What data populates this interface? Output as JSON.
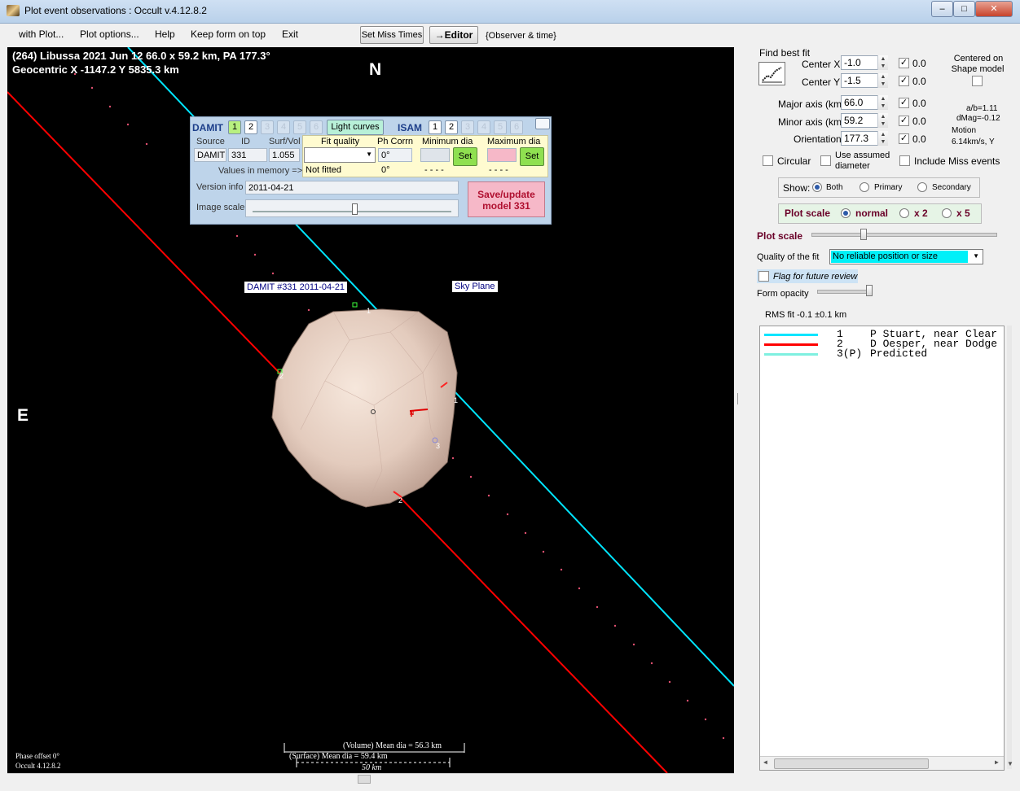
{
  "window": {
    "title": "Plot event observations : Occult v.4.12.8.2",
    "min": "–",
    "max": "□",
    "close": "✕"
  },
  "menu": {
    "items": [
      "with Plot...",
      "Plot options...",
      "Help",
      "Keep form on top",
      "Exit"
    ],
    "set_miss_times": "Set Miss Times",
    "editor": "→Editor",
    "observer_time": "{Observer & time}"
  },
  "plot": {
    "header_line1": "(264) Libussa  2021 Jun 12   66.0 x 59.2 km, PA 177.3°",
    "header_line2": "Geocentric  X  -1147.2  Y 5835.3 km",
    "north": "N",
    "east": "E",
    "damit_label": "DAMIT #331 2011-04-21",
    "sky_plane": "Sky Plane",
    "chord_labels": [
      "1",
      "2",
      "1",
      "2",
      "3"
    ],
    "pole_marker": "N",
    "phase_offset": "Phase offset 0°",
    "occult_version": "Occult 4.12.8.2",
    "volume_mean": "(Volume) Mean dia = 56.3 km",
    "surface_mean": "(Surface) Mean dia = 59.4 km",
    "scale_bar": "50 km"
  },
  "damit": {
    "title": "DAMIT",
    "model_nums": [
      "1",
      "2",
      "3",
      "4",
      "5",
      "6"
    ],
    "light_curves": "Light curves",
    "isam": "ISAM",
    "isam_nums": [
      "1",
      "2",
      "3",
      "4",
      "5",
      "6"
    ],
    "col_source": "Source",
    "col_id": "ID",
    "col_surf_vol": "Surf/Vol",
    "source_value": "DAMIT",
    "id_value": "331",
    "surf_vol_value": "1.055",
    "values_in_memory": "Values in memory =>",
    "fit_quality": "Fit quality",
    "ph_corrn": "Ph Corrn",
    "minimum_dia": "Minimum dia",
    "maximum_dia": "Maximum dia",
    "ph_value": "0°",
    "ph_mem": "0°",
    "not_fitted": "Not fitted",
    "min_mem": "- - - -",
    "max_mem": "- - - -",
    "set": "Set",
    "version_info": "Version info",
    "version_value": "2011-04-21",
    "image_scale": "Image scale",
    "save_update": "Save/update",
    "model_331": "model 331"
  },
  "right": {
    "find_best_fit": "Find best fit",
    "center_x": "Center X",
    "center_x_val": "-1.0",
    "center_y": "Center Y",
    "center_y_val": "-1.5",
    "major_axis": "Major axis (km)",
    "major_val": "66.0",
    "minor_axis": "Minor axis (km)",
    "minor_val": "59.2",
    "orientation": "Orientation",
    "orient_val": "177.3",
    "zero": "0.0",
    "centered_on": "Centered on",
    "shape_model": "Shape model",
    "ab": "a/b=1.11",
    "dmag": "dMag=-0.12",
    "motion": "Motion",
    "motion_val": "6.14km/s, Y",
    "circular": "Circular",
    "use_assumed": "Use assumed",
    "diameter": "diameter",
    "include_miss": "Include Miss events",
    "show": "Show:",
    "both": "Both",
    "primary": "Primary",
    "secondary": "Secondary",
    "plot_scale": "Plot scale",
    "normal": "normal",
    "x2": "x 2",
    "x5": "x 5",
    "plot_scale2": "Plot scale",
    "quality_label": "Quality of the fit",
    "quality_value": "No reliable position or size",
    "flag": "Flag for future review",
    "form_opacity": "Form opacity",
    "rms": "RMS fit -0.1 ±0.1 km"
  },
  "legend": [
    {
      "num": "1",
      "text": "P Stuart, near Clear",
      "color": "#00e5ff"
    },
    {
      "num": "2",
      "text": "D Oesper, near Dodge",
      "color": "#ff0000"
    },
    {
      "num": "3(P)",
      "text": "Predicted",
      "color": "#7ff0e0"
    }
  ]
}
